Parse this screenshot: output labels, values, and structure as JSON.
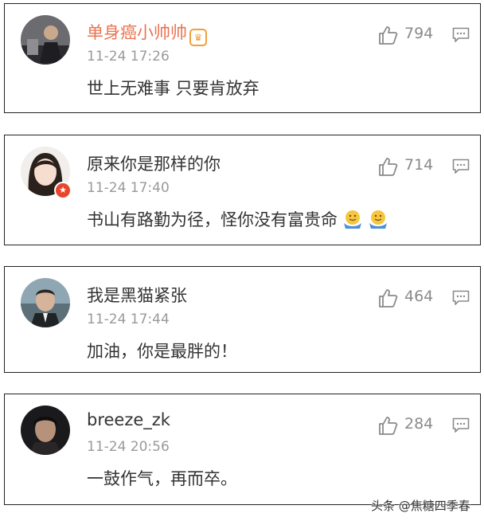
{
  "comments": [
    {
      "name": "单身癌小帅帅",
      "time": "11-24 17:26",
      "text": "世上无难事 只要肯放弃",
      "likes": "794",
      "name_color": "#eb7350"
    },
    {
      "name": "原来你是那样的你",
      "time": "11-24 17:40",
      "text": "书山有路勤为径，怪你没有富贵命",
      "likes": "714"
    },
    {
      "name": "我是黑猫紧张",
      "time": "11-24 17:44",
      "text": "加油，你是最胖的！",
      "likes": "464"
    },
    {
      "name": "breeze_zk",
      "time": "11-24 20:56",
      "text": "一鼓作气，再而卒。",
      "likes": "284"
    }
  ],
  "icons": {
    "like": "thumbs-up-icon",
    "comment": "comment-icon",
    "verified": "verified-badge-icon",
    "vip": "vip-crown-icon",
    "emoji": "shrug-emoji-icon"
  },
  "watermark": "头条 @焦糖四季春"
}
